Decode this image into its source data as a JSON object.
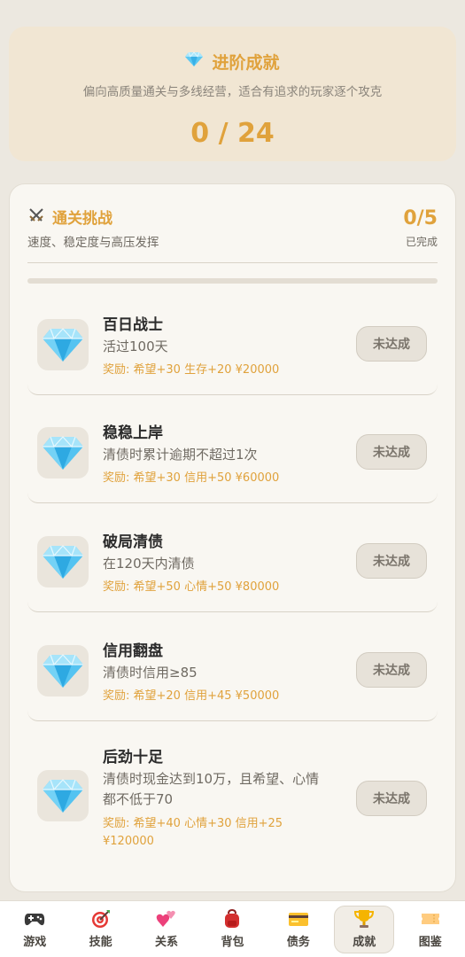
{
  "hero": {
    "icon": "diamond-icon",
    "title": "进阶成就",
    "subtitle": "偏向高质量通关与多线经营，适合有追求的玩家逐个攻克",
    "count": "0 / 24"
  },
  "section": {
    "icon": "crossed-swords-icon",
    "title": "通关挑战",
    "subtitle": "速度、稳定度与高压发挥",
    "count": "0/5",
    "count_label": "已完成",
    "progress_fraction": 0
  },
  "achievements": [
    {
      "title": "百日战士",
      "desc": "活过100天",
      "reward": "奖励: 希望+30 生存+20 ¥20000",
      "status": "未达成"
    },
    {
      "title": "稳稳上岸",
      "desc": "清债时累计逾期不超过1次",
      "reward": "奖励: 希望+30 信用+50 ¥60000",
      "status": "未达成"
    },
    {
      "title": "破局清债",
      "desc": "在120天内清债",
      "reward": "奖励: 希望+50 心情+50 ¥80000",
      "status": "未达成"
    },
    {
      "title": "信用翻盘",
      "desc": "清债时信用≥85",
      "reward": "奖励: 希望+20 信用+45 ¥50000",
      "status": "未达成"
    },
    {
      "title": "后劲十足",
      "desc": "清债时现金达到10万，且希望、心情都不低于70",
      "reward": "奖励: 希望+40 心情+30 信用+25 ¥120000",
      "status": "未达成"
    }
  ],
  "tabs": [
    {
      "label": "游戏",
      "icon": "gamepad-icon",
      "active": false
    },
    {
      "label": "技能",
      "icon": "target-icon",
      "active": false
    },
    {
      "label": "关系",
      "icon": "hearts-icon",
      "active": false
    },
    {
      "label": "背包",
      "icon": "backpack-icon",
      "active": false
    },
    {
      "label": "债务",
      "icon": "credit-card-icon",
      "active": false
    },
    {
      "label": "成就",
      "icon": "trophy-icon",
      "active": true
    },
    {
      "label": "图鉴",
      "icon": "ticket-icon",
      "active": false
    }
  ],
  "colors": {
    "accent": "#E0A23C",
    "background": "#ECE8E0",
    "card": "#F9F7F2"
  }
}
